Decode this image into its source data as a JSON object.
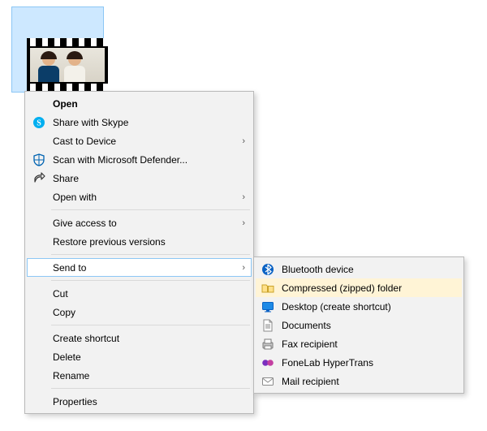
{
  "file": {
    "alt": "Selected video file"
  },
  "main_menu": {
    "open": "Open",
    "skype": "Share with Skype",
    "cast": "Cast to Device",
    "defender": "Scan with Microsoft Defender...",
    "share": "Share",
    "open_with": "Open with",
    "give_access": "Give access to",
    "restore": "Restore previous versions",
    "send_to": "Send to",
    "cut": "Cut",
    "copy": "Copy",
    "create_shortcut": "Create shortcut",
    "delete": "Delete",
    "rename": "Rename",
    "properties": "Properties"
  },
  "send_to_menu": {
    "bluetooth": "Bluetooth device",
    "zip": "Compressed (zipped) folder",
    "desktop": "Desktop (create shortcut)",
    "documents": "Documents",
    "fax": "Fax recipient",
    "hypertrans": "FoneLab HyperTrans",
    "mail": "Mail recipient"
  },
  "glyphs": {
    "chevron": "›"
  }
}
